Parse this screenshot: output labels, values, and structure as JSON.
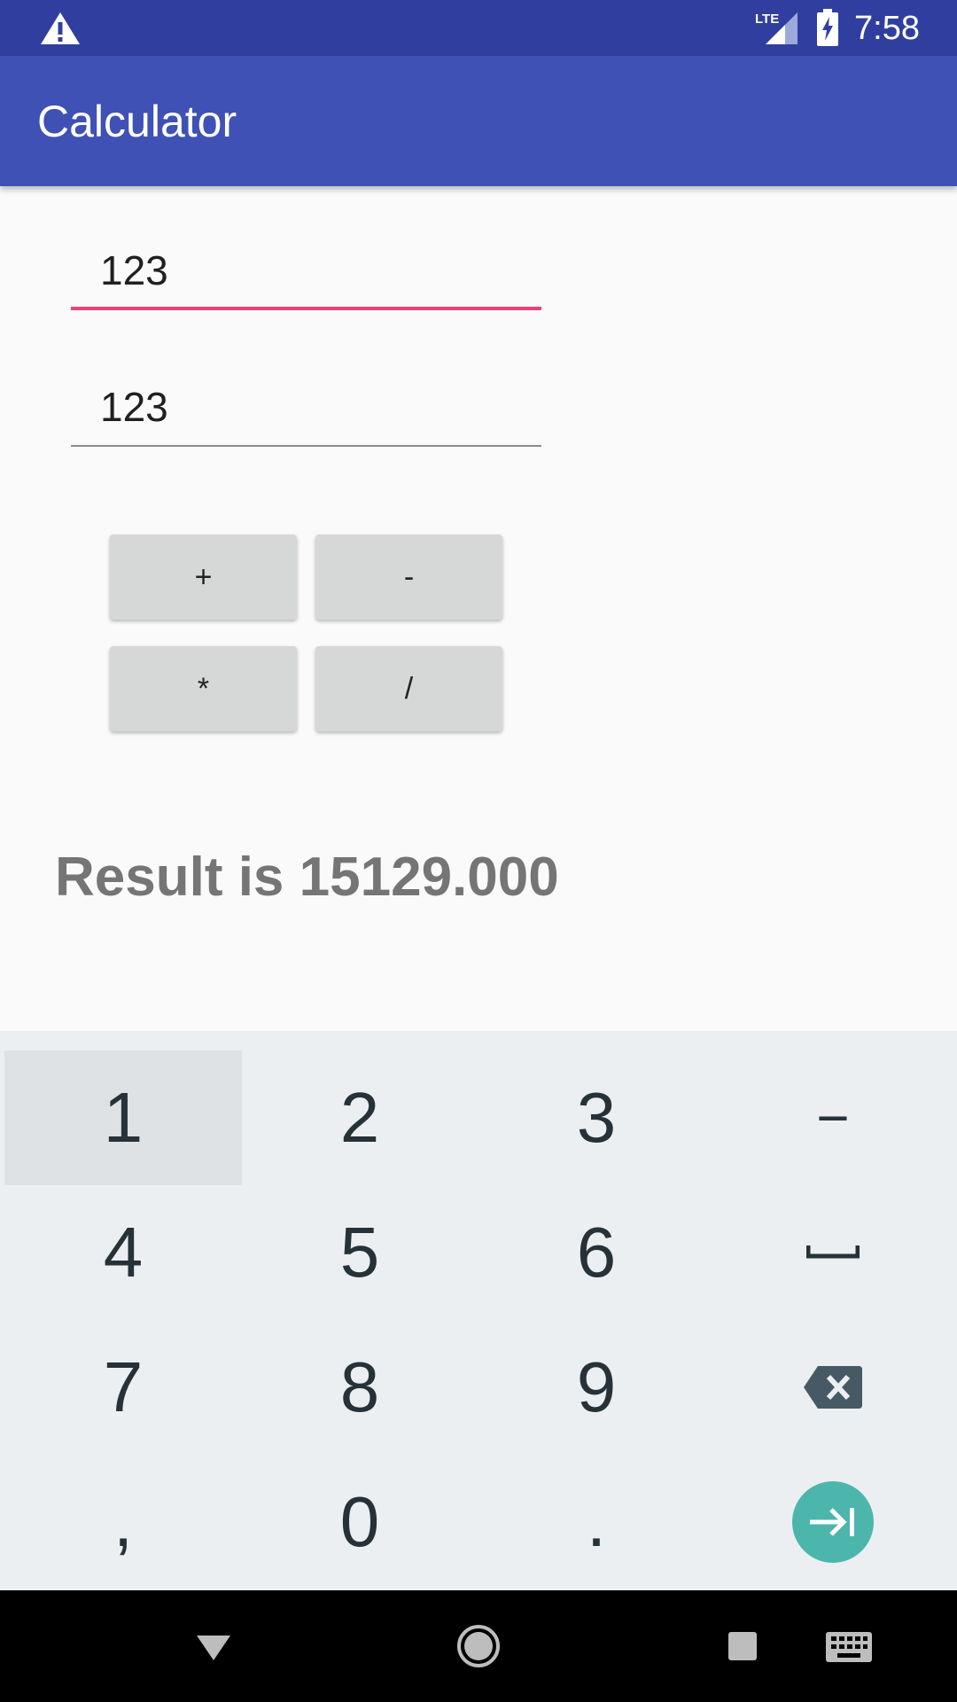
{
  "status_bar": {
    "time": "7:58",
    "network": "LTE",
    "icons": [
      "warning-icon",
      "lte-signal-icon",
      "battery-charging-icon"
    ]
  },
  "app_bar": {
    "title": "Calculator"
  },
  "inputs": [
    {
      "value": "123",
      "focused": true
    },
    {
      "value": "123",
      "focused": false
    }
  ],
  "operators": {
    "plus": "+",
    "minus": "-",
    "multiply": "*",
    "divide": "/"
  },
  "result": {
    "text": "Result is 15129.000"
  },
  "keyboard": {
    "keys": {
      "k1": "1",
      "k2": "2",
      "k3": "3",
      "dash": "−",
      "k4": "4",
      "k5": "5",
      "k6": "6",
      "k7": "7",
      "k8": "8",
      "k9": "9",
      "comma": ",",
      "k0": "0",
      "period": "."
    },
    "icons": [
      "space-icon",
      "backspace-icon",
      "next-field-icon"
    ]
  },
  "nav_bar": {
    "icons": [
      "back-icon",
      "home-icon",
      "recents-icon",
      "keyboard-switch-icon"
    ]
  },
  "colors": {
    "status_bar": "#303f9f",
    "app_bar": "#3f51b5",
    "focus_underline": "#ec407a",
    "next_button": "#4db6ac"
  }
}
